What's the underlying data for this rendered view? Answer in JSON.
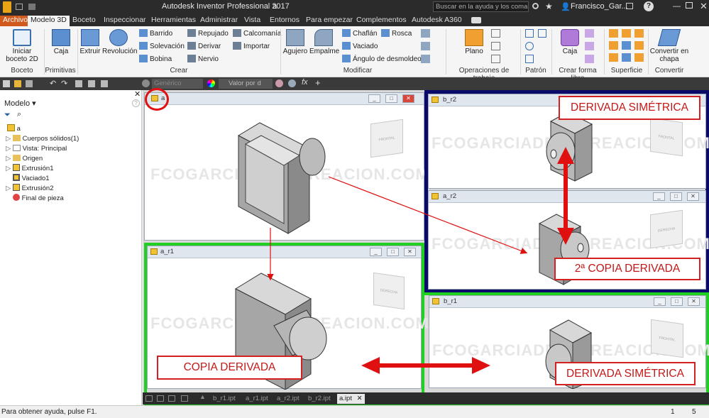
{
  "app": {
    "title": "Autodesk Inventor Professional 2017",
    "document": "a"
  },
  "search": {
    "placeholder": "Buscar en la ayuda y los comandos"
  },
  "user": {
    "name": "Francisco_Gar..."
  },
  "tabs": [
    "Archivo",
    "Modelo 3D",
    "Boceto",
    "Inspeccionar",
    "Herramientas",
    "Administrar",
    "Vista",
    "Entornos",
    "Para empezar",
    "Complementos",
    "Autodesk A360"
  ],
  "ribbon": {
    "boceto": {
      "start": "Iniciar boceto 2D",
      "group": "Boceto"
    },
    "primitivas": {
      "box": "Caja",
      "group": "Primitivas"
    },
    "crear": {
      "extrude": "Extruir",
      "revolve": "Revolución",
      "sweep": "Barrido",
      "loft": "Solevación",
      "coil": "Bobina",
      "emboss": "Repujado",
      "derive": "Derivar",
      "rib": "Nervio",
      "decal": "Calcomanía",
      "import": "Importar",
      "group": "Crear"
    },
    "modificar": {
      "hole": "Agujero",
      "fillet": "Empalme",
      "chamfer": "Chaflán",
      "shell": "Vaciado",
      "draft": "Ángulo de desmoldeo",
      "thread": "Rosca",
      "group": "Modificar"
    },
    "workfeat": {
      "plane": "Plano",
      "group": "Operaciones de trabajo"
    },
    "pattern": {
      "group": "Patrón"
    },
    "freeform": {
      "box": "Caja",
      "group": "Crear forma libre"
    },
    "surface": {
      "group": "Superficie"
    },
    "convert": {
      "label": "Convertir en chapa",
      "group": "Convertir"
    }
  },
  "qat": {
    "material": "Genérico",
    "appearance": "Valor por d"
  },
  "browser": {
    "title": "Modelo",
    "items": [
      "a",
      "Cuerpos sólidos(1)",
      "Vista: Principal",
      "Origen",
      "Extrusión1",
      "Vaciado1",
      "Extrusión2",
      "Final de pieza"
    ]
  },
  "windows": {
    "a": "a",
    "a_r1": "a_r1",
    "b_r2": "b_r2",
    "a_r2": "a_r2",
    "b_r1": "b_r1"
  },
  "watermark": "FCOGARCIADELACREACION.COM",
  "callouts": {
    "simetrica_top": "DERIVADA SIMÉTRICA",
    "segunda": "2ª COPIA DERIVADA",
    "copia": "COPIA DERIVADA",
    "simetrica_bottom": "DERIVADA SIMÉTRICA"
  },
  "viewcube": {
    "front": "FRONTAL",
    "right": "DERECHA",
    "top": "SUPERIOR"
  },
  "doctabs": [
    "b_r1.ipt",
    "a_r1.ipt",
    "a_r2.ipt",
    "b_r2.ipt",
    "a.ipt"
  ],
  "status": {
    "help": "Para obtener ayuda, pulse F1.",
    "n1": "1",
    "n2": "5"
  },
  "colors": {
    "accent_red": "#e01010",
    "frame_green": "#20d020",
    "frame_navy": "#0a0a6a",
    "file_tab": "#cf5a1c"
  }
}
